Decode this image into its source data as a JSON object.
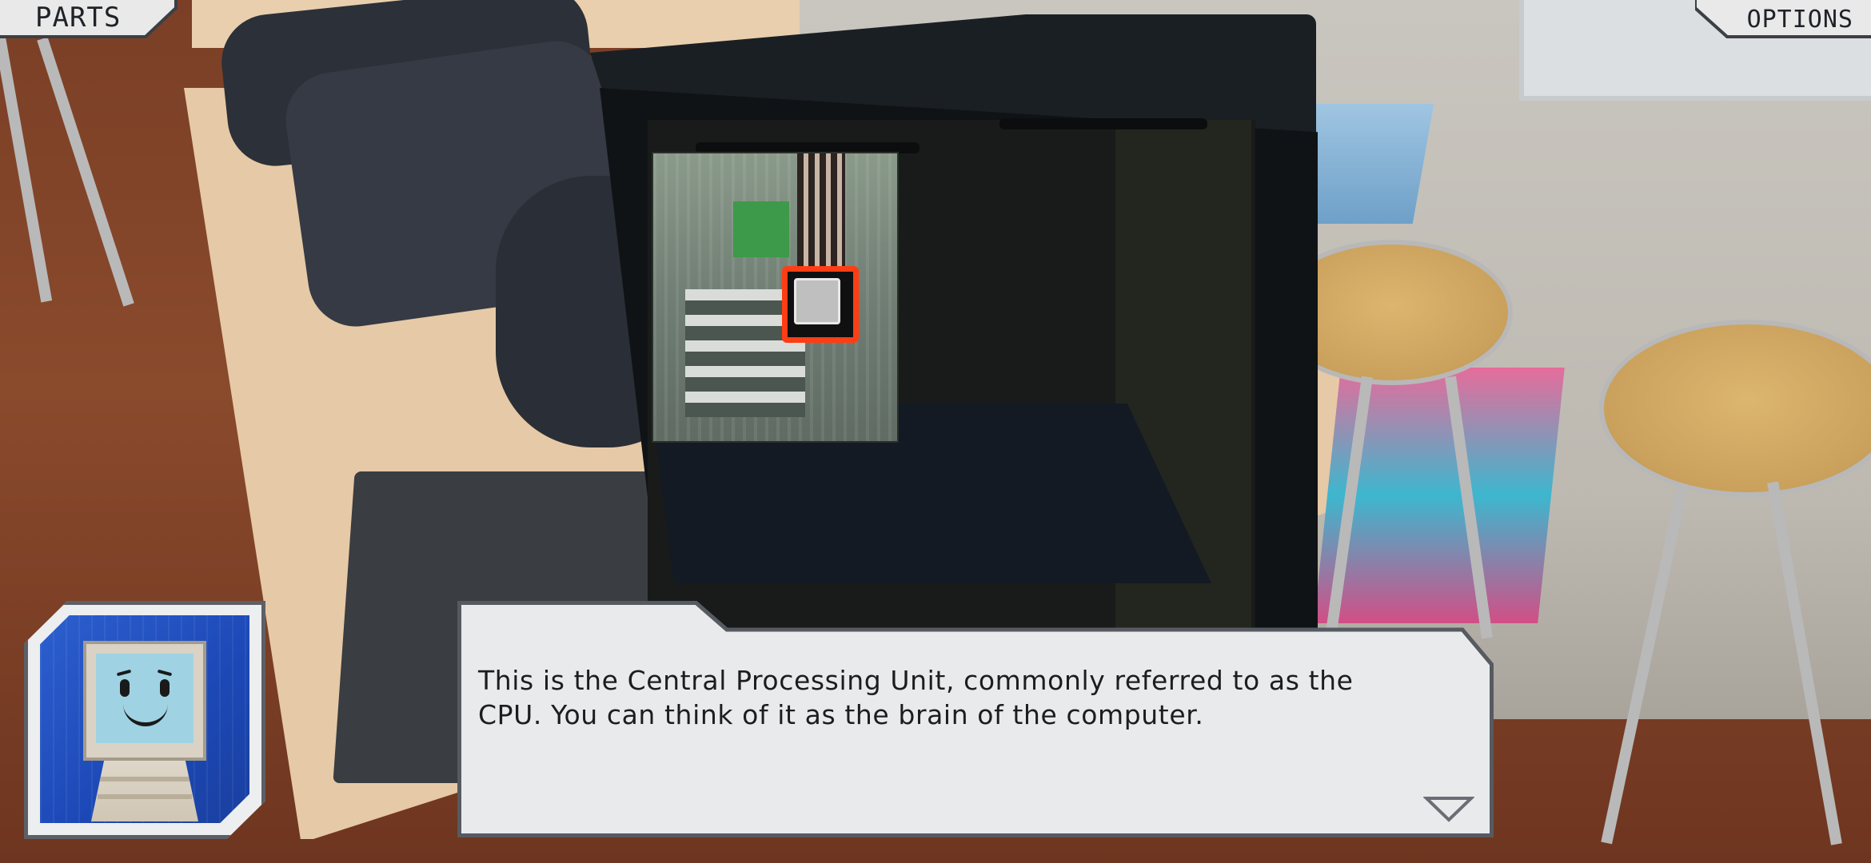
{
  "hud": {
    "parts_label": "PARTS",
    "options_label": "OPTIONS"
  },
  "dialogue": {
    "text_line1": "This is the Central Processing Unit, commonly referred to as the",
    "text_line2": "CPU. You can think of it as the brain of the computer.",
    "next_icon": "triangle-down-icon"
  },
  "scene": {
    "highlighted_part": "cpu",
    "highlight_color": "#ff3d14",
    "avatar": "computer-mascot-icon"
  }
}
